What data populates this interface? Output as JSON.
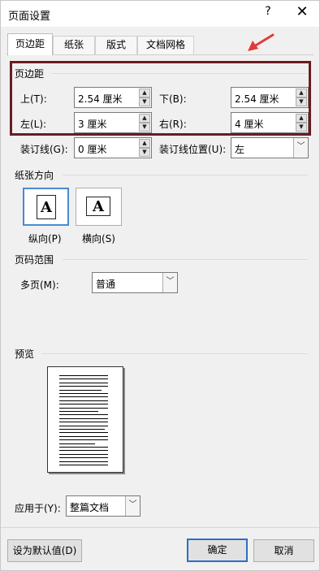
{
  "window": {
    "title": "页面设置",
    "help": "?",
    "close": "✕"
  },
  "tabs": [
    "页边距",
    "纸张",
    "版式",
    "文档网格"
  ],
  "margins": {
    "section": "页边距",
    "top_label": "上(T):",
    "top_value": "2.54 厘米",
    "bottom_label": "下(B):",
    "bottom_value": "2.54 厘米",
    "left_label": "左(L):",
    "left_value": "3 厘米",
    "right_label": "右(R):",
    "right_value": "4 厘米",
    "gutter_label": "装订线(G):",
    "gutter_value": "0 厘米",
    "gutter_pos_label": "装订线位置(U):",
    "gutter_pos_value": "左"
  },
  "orientation": {
    "section": "纸张方向",
    "portrait": "纵向(P)",
    "landscape": "横向(S)",
    "icon_letter": "A"
  },
  "pages": {
    "section": "页码范围",
    "multi_label": "多页(M):",
    "multi_value": "普通"
  },
  "preview": {
    "section": "预览"
  },
  "apply": {
    "label": "应用于(Y):",
    "value": "整篇文档"
  },
  "buttons": {
    "default": "设为默认值(D)",
    "ok": "确定",
    "cancel": "取消"
  },
  "colors": {
    "highlight_border": "#6b1b22",
    "annotation_arrow": "#e23a3a",
    "focus_blue": "#2a6fc7"
  }
}
